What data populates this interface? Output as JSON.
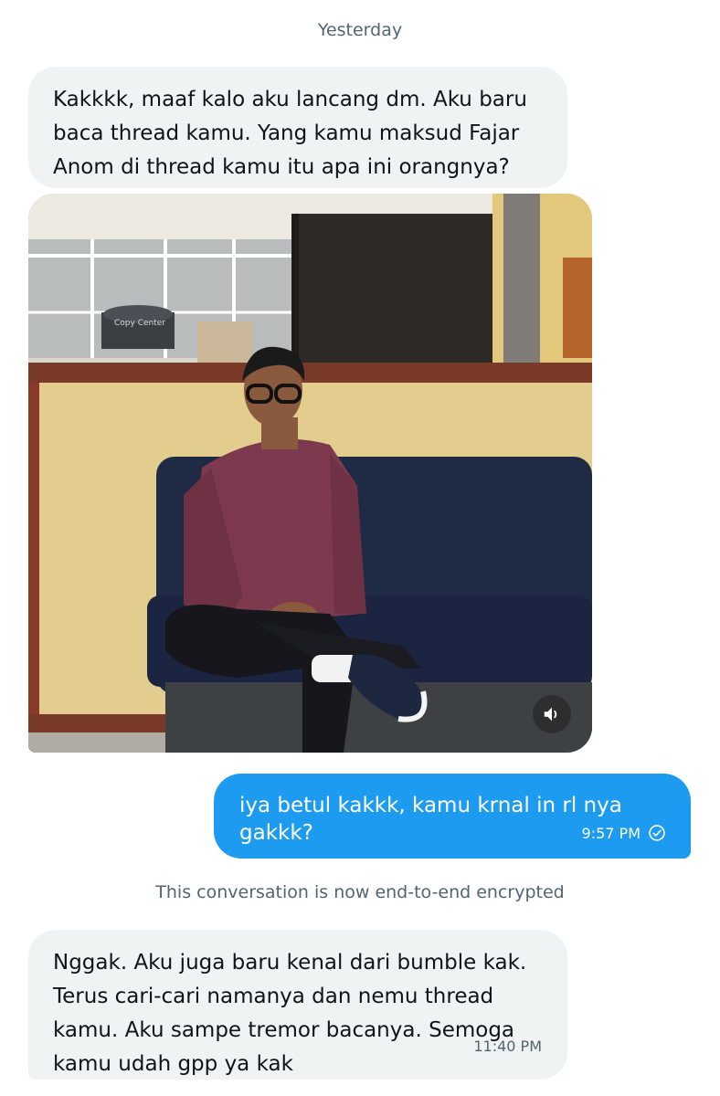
{
  "date_separator": "Yesterday",
  "messages": [
    {
      "direction": "incoming",
      "text": "Kakkkk, maaf kalo aku lancang dm. Aku baru baca thread kamu. Yang kamu maksud Fajar Anom di thread kamu itu apa ini orangnya?"
    },
    {
      "direction": "incoming",
      "type": "photo",
      "photo_text": "Copy Center",
      "media_control_icon": "speaker-icon"
    },
    {
      "direction": "outgoing",
      "text": "iya betul kakkk, kamu krnal in rl nya gakkk?",
      "time": "9:57 PM",
      "status_icon": "check-circle-icon"
    },
    {
      "direction": "incoming",
      "text": "Nggak. Aku juga baru kenal dari bumble kak. Terus cari-cari namanya dan nemu thread kamu. Aku sampe tremor bacanya. Semoga kamu udah gpp ya kak",
      "time": "11:40 PM"
    }
  ],
  "encryption_notice": "This conversation is now end-to-end encrypted",
  "colors": {
    "outgoing_bubble": "#1d9bf0",
    "incoming_bubble": "#eff3f4",
    "secondary_text": "#536471",
    "primary_text": "#0f1419"
  }
}
